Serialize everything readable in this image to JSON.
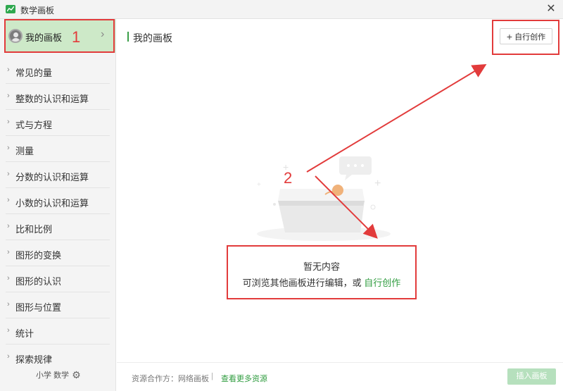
{
  "window": {
    "title": "数学画板",
    "close_symbol": "✕"
  },
  "sidebar": {
    "my_board_label": "我的画板",
    "items": [
      {
        "label": "常见的量"
      },
      {
        "label": "整数的认识和运算"
      },
      {
        "label": "式与方程"
      },
      {
        "label": "测量"
      },
      {
        "label": "分数的认识和运算"
      },
      {
        "label": "小数的认识和运算"
      },
      {
        "label": "比和比例"
      },
      {
        "label": "图形的变换"
      },
      {
        "label": "图形的认识"
      },
      {
        "label": "图形与位置"
      },
      {
        "label": "统计"
      },
      {
        "label": "探索规律"
      }
    ],
    "footer_label": "小学 数学"
  },
  "main": {
    "title": "我的画板",
    "create_button": "自行创作",
    "empty_title": "暂无内容",
    "empty_desc_prefix": "可浏览其他画板进行编辑，或 ",
    "empty_desc_link": "自行创作"
  },
  "footer": {
    "resource_text": "资源合作方：网络画板",
    "separator": "|",
    "more_link": "查看更多资源",
    "insert_button": "插入画板"
  },
  "annotations": {
    "label_1": "1",
    "label_2": "2",
    "color": "#e23b3b"
  },
  "colors": {
    "accent_green": "#2f9c3f",
    "selected_bg": "#cde9c8",
    "insert_disabled": "#b6e0bd"
  }
}
